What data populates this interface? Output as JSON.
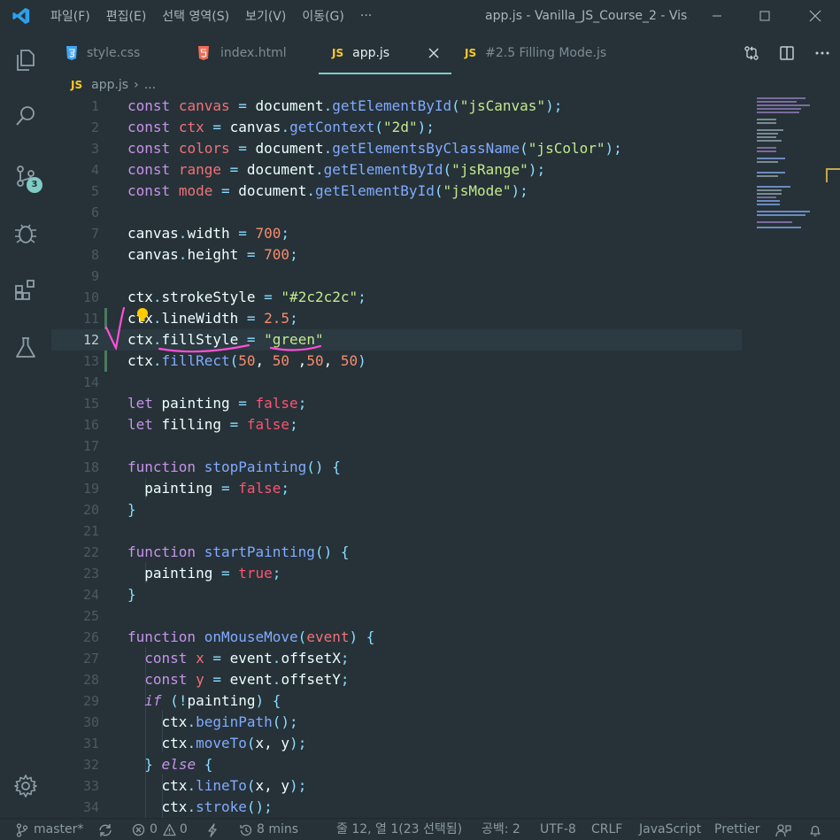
{
  "titlebar": {
    "menu": [
      "파일(F)",
      "편집(E)",
      "선택 영역(S)",
      "보기(V)",
      "이동(G)",
      "···"
    ],
    "title": "app.js - Vanilla_JS_Course_2 - Vis..."
  },
  "activity": {
    "scm_badge": "3"
  },
  "tabs": [
    {
      "badge": "CSS",
      "label": "style.css"
    },
    {
      "badge": "HTML",
      "label": "index.html"
    },
    {
      "badge": "JS",
      "label": "app.js"
    },
    {
      "badge": "JS",
      "label": "#2.5 Filling Mode.js"
    }
  ],
  "breadcrumb": {
    "badge": "JS",
    "file": "app.js",
    "sep": "›",
    "more": "..."
  },
  "editor": {
    "current_line": 12,
    "line_numbers": [
      "1",
      "2",
      "3",
      "4",
      "5",
      "6",
      "7",
      "8",
      "9",
      "10",
      "11",
      "12",
      "13",
      "14",
      "15",
      "16",
      "17",
      "18",
      "19",
      "20",
      "21",
      "22",
      "23",
      "24",
      "25",
      "26",
      "27",
      "28",
      "29",
      "30",
      "31",
      "32",
      "33",
      "34"
    ]
  },
  "statusbar": {
    "branch": "master*",
    "errors": "0",
    "warnings": "0",
    "time": "8 mins",
    "position": "줄 12, 열 1(23 선택됨)",
    "spaces": "공백: 2",
    "encoding": "UTF-8",
    "eol": "CRLF",
    "language": "JavaScript",
    "formatter": "Prettier"
  },
  "colors": {
    "background": "#263238",
    "accent": "#80cbc4",
    "keyword": "#c792ea",
    "function": "#82aaff",
    "string": "#c3e88d",
    "number": "#f78c6c",
    "variable": "#f07178",
    "annotation": "#ff4fd8"
  }
}
